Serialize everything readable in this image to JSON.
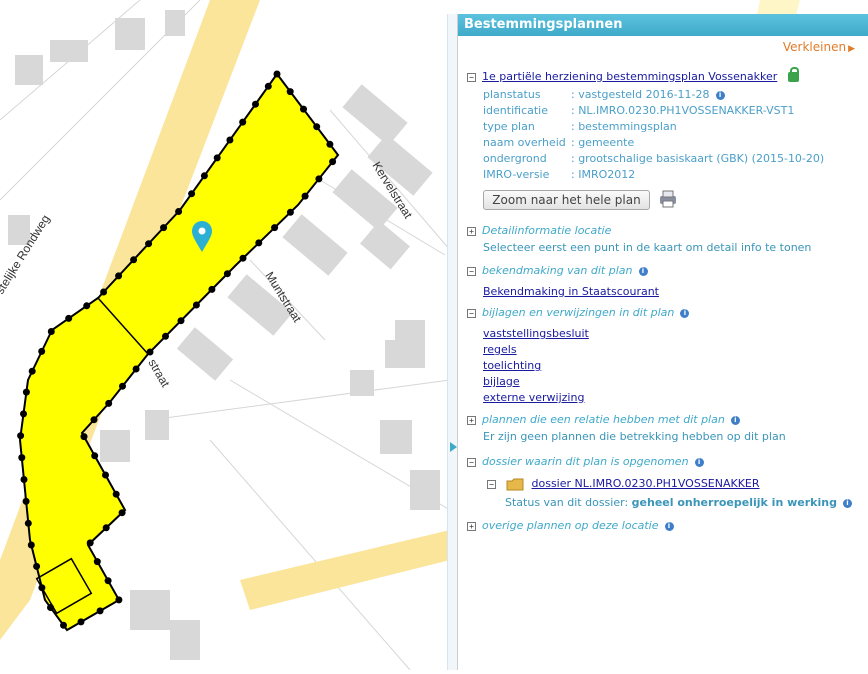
{
  "map": {
    "street_labels": [
      "Kervelstraat",
      "Muntstraat",
      "straat",
      "stelijke Rondweg"
    ],
    "colors": {
      "plan_fill": "#ffff00",
      "road": "#fae59a",
      "building": "#d8d8d8"
    }
  },
  "panel": {
    "title": "Bestemmingsplannen",
    "shrink_label": "Verkleinen",
    "plan": {
      "toggle": "−",
      "title": "1e partiële herziening bestemmingsplan Vossenakker",
      "attributes": [
        {
          "key": "planstatus",
          "value": ": vastgesteld 2016-11-28"
        },
        {
          "key": "identificatie",
          "value": ": NL.IMRO.0230.PH1VOSSENAKKER-VST1"
        },
        {
          "key": "type plan",
          "value": ": bestemmingsplan"
        },
        {
          "key": "naam overheid",
          "value": ": gemeente"
        },
        {
          "key": "ondergrond",
          "value": ": grootschalige basiskaart (GBK) (2015-10-20)"
        },
        {
          "key": "IMRO-versie",
          "value": ": IMRO2012"
        }
      ],
      "zoom_button": "Zoom naar het hele plan"
    },
    "detail": {
      "title": "Detailinformatie locatie",
      "text": "Selecteer eerst een punt in de kaart om detail info te tonen"
    },
    "bekendmaking": {
      "title": "bekendmaking van dit plan",
      "link": "Bekendmaking in Staatscourant"
    },
    "bijlagen": {
      "title": "bijlagen en verwijzingen in dit plan",
      "links": [
        "vaststellingsbesluit",
        "regels",
        "toelichting",
        "bijlage",
        "externe verwijzing"
      ]
    },
    "relaties": {
      "title": "plannen die een relatie hebben met dit plan",
      "text": "Er zijn geen plannen die betrekking hebben op dit plan"
    },
    "dossier": {
      "title": "dossier waarin dit plan is opgenomen",
      "link": "dossier NL.IMRO.0230.PH1VOSSENAKKER",
      "status_label": "Status van dit dossier:",
      "status_value": "geheel onherroepelijk in werking"
    },
    "overige": {
      "title": "overige plannen op deze locatie"
    }
  }
}
